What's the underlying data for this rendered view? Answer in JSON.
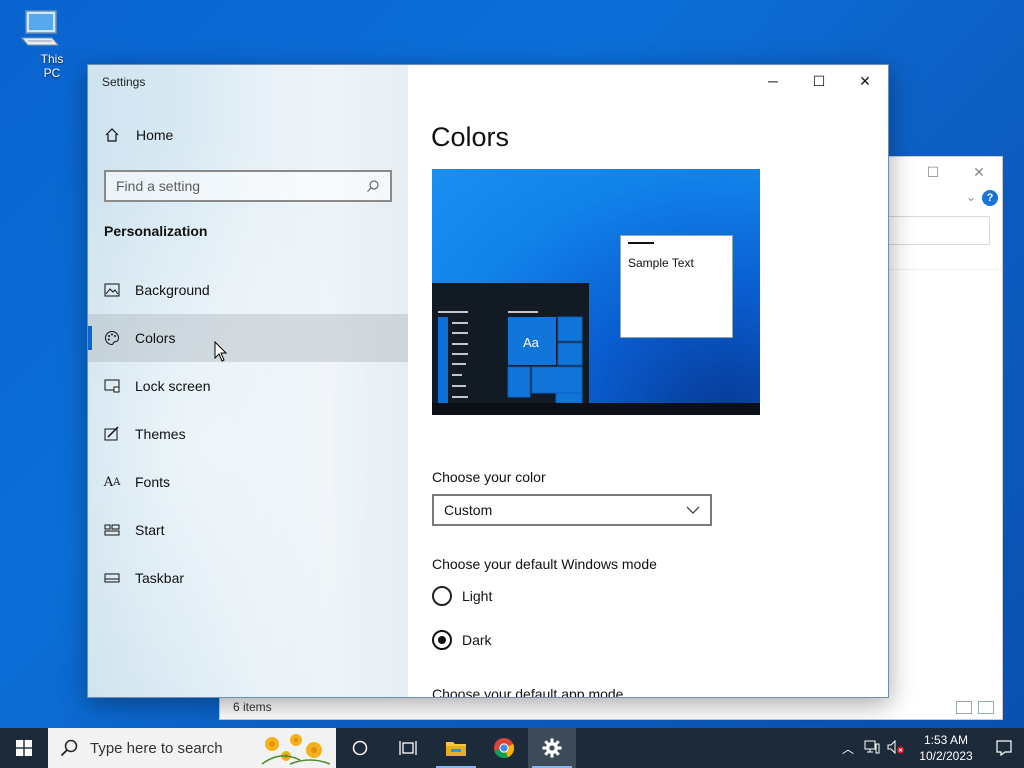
{
  "desktop": {
    "icon_label": "This PC"
  },
  "explorer": {
    "status_items": "6 items",
    "help": "?"
  },
  "settings": {
    "window_title": "Settings",
    "home_label": "Home",
    "search_placeholder": "Find a setting",
    "section_heading": "Personalization",
    "nav_items": [
      {
        "label": "Background",
        "icon": "picture-icon"
      },
      {
        "label": "Colors",
        "icon": "palette-icon",
        "active": true
      },
      {
        "label": "Lock screen",
        "icon": "lock-screen-icon"
      },
      {
        "label": "Themes",
        "icon": "themes-icon"
      },
      {
        "label": "Fonts",
        "icon": "fonts-icon"
      },
      {
        "label": "Start",
        "icon": "start-icon"
      },
      {
        "label": "Taskbar",
        "icon": "taskbar-icon"
      }
    ],
    "page_title": "Colors",
    "preview": {
      "sample_text": "Sample Text",
      "tile_text": "Aa"
    },
    "choose_color_label": "Choose your color",
    "choose_color_value": "Custom",
    "windows_mode_label": "Choose your default Windows mode",
    "windows_mode_options": [
      "Light",
      "Dark"
    ],
    "windows_mode_selected": "Dark",
    "app_mode_label": "Choose your default app mode"
  },
  "taskbar": {
    "search_placeholder": "Type here to search",
    "clock_time": "1:53 AM",
    "clock_date": "10/2/2023"
  },
  "colors": {
    "accent": "#0a64d0",
    "taskbar_bg": "#1c2a3a",
    "desktop_blue": "#0b6fd8"
  }
}
